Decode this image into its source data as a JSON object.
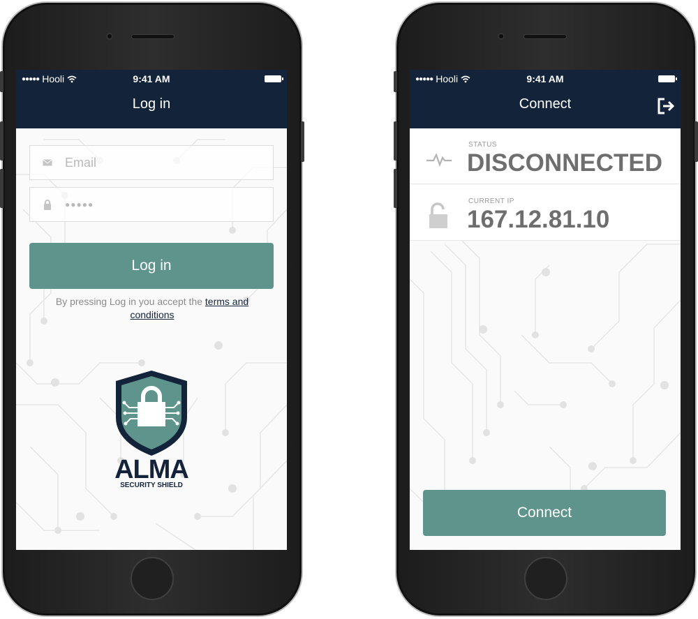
{
  "login_screen": {
    "status_bar": {
      "dots": "●●●●●",
      "carrier": "Hooli",
      "time": "9:41 AM"
    },
    "title": "Log in",
    "email": {
      "placeholder": "Email"
    },
    "password": {
      "value": "●●●●●"
    },
    "login_button": "Log in",
    "terms": {
      "prefix": "By pressing Log in you accept the ",
      "link": "terms and conditions"
    },
    "logo": {
      "name": "ALMA",
      "tagline": "SECURITY SHIELD"
    }
  },
  "connect_screen": {
    "status_bar": {
      "dots": "●●●●●",
      "carrier": "Hooli",
      "time": "9:41 AM"
    },
    "title": "Connect",
    "status": {
      "label": "STATUS",
      "value": "DISCONNECTED"
    },
    "current_ip": {
      "label": "CURRENT IP",
      "value": "167.12.81.10"
    },
    "connect_button": "Connect"
  },
  "colors": {
    "nav": "#13233a",
    "accent": "#5e948c",
    "background": "#fafafa"
  },
  "icons": [
    "wifi-icon",
    "battery-icon",
    "mail-icon",
    "lock-icon",
    "shield-lock-icon",
    "activity-icon",
    "unlock-icon",
    "logout-icon"
  ]
}
